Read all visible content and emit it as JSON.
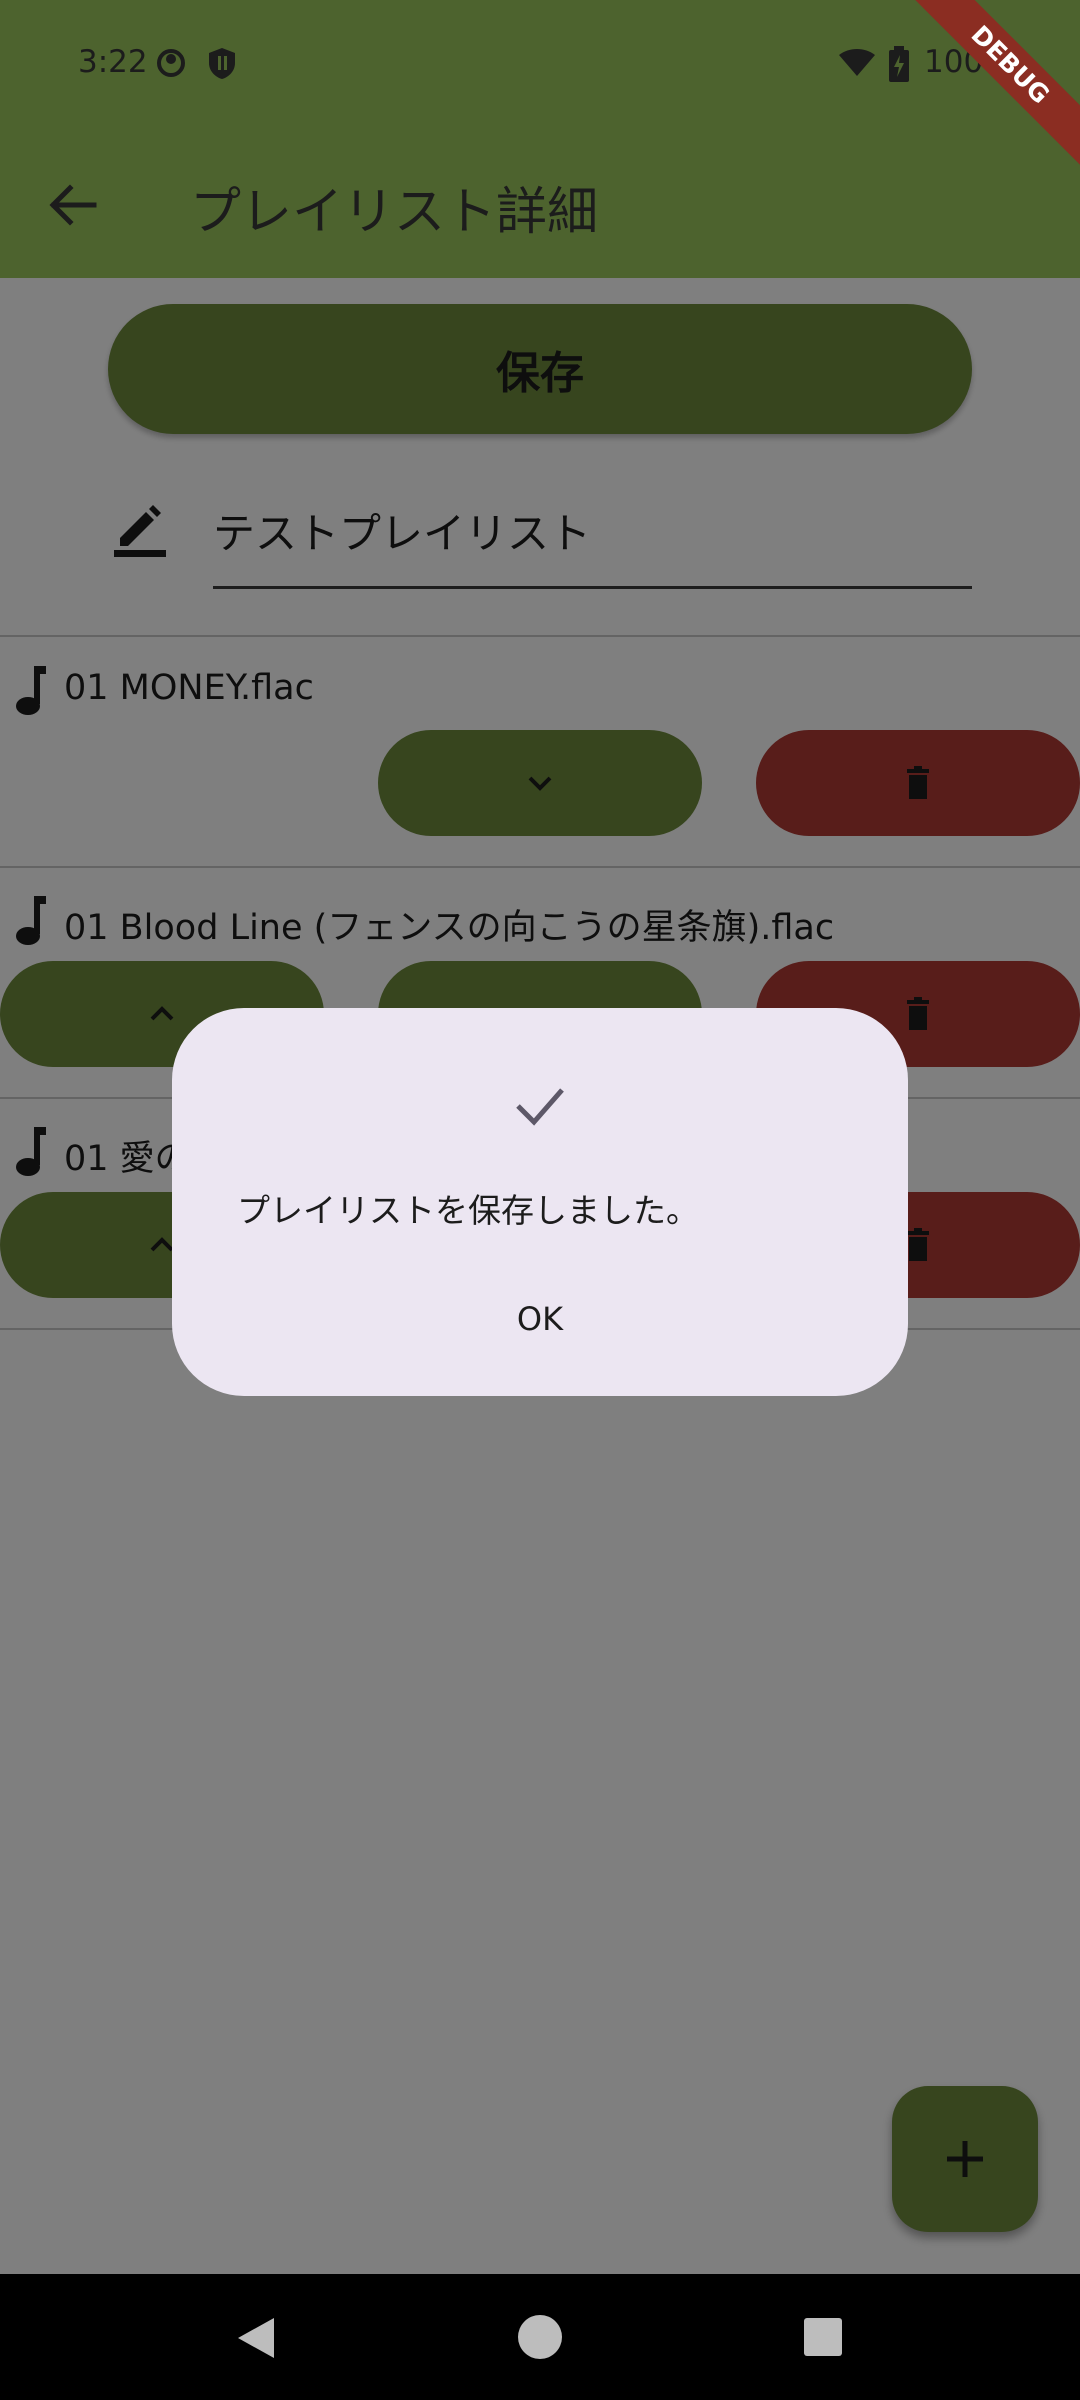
{
  "status_bar": {
    "time": "3:22",
    "battery": "100%"
  },
  "debug_banner": "DEBUG",
  "app_bar": {
    "title": "プレイリスト詳細"
  },
  "save_button": {
    "label": "保存"
  },
  "playlist": {
    "name": "テストプレイリスト"
  },
  "tracks": [
    {
      "title": "01 MONEY.flac"
    },
    {
      "title": "01 Blood Line (フェンスの向こうの星条旗).flac"
    },
    {
      "title": "01 愛の"
    }
  ],
  "dialog": {
    "message": "プレイリストを保存しました。",
    "ok_label": "OK"
  },
  "colors": {
    "primary": "#6e8b3d",
    "appbar": "#4d632e",
    "danger": "#b03a34",
    "dialog": "#ece6f2"
  }
}
